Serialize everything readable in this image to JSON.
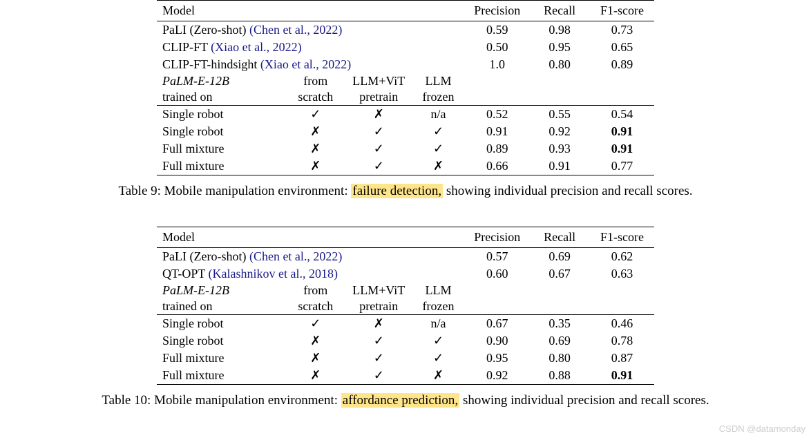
{
  "table9": {
    "headers": {
      "model": "Model",
      "precision": "Precision",
      "recall": "Recall",
      "f1": "F1-score"
    },
    "baselines": [
      {
        "name": "PaLI (Zero-shot) ",
        "cite": "(Chen et al., 2022)",
        "precision": "0.59",
        "recall": "0.98",
        "f1": "0.73"
      },
      {
        "name": "CLIP-FT ",
        "cite": "(Xiao et al., 2022)",
        "precision": "0.50",
        "recall": "0.95",
        "f1": "0.65"
      },
      {
        "name": "CLIP-FT-hindsight ",
        "cite": "(Xiao et al., 2022)",
        "precision": "1.0",
        "recall": "0.80",
        "f1": "0.89"
      }
    ],
    "subheader": {
      "model_name": "PaLM-E-12B",
      "trained_on": "trained on",
      "col1_top": "from",
      "col1_bot": "scratch",
      "col2_top": "LLM+ViT",
      "col2_bot": "pretrain",
      "col3_top": "LLM",
      "col3_bot": "frozen"
    },
    "rows": [
      {
        "label": "Single robot",
        "c1": "✓",
        "c2": "✗",
        "c3": "n/a",
        "precision": "0.52",
        "recall": "0.55",
        "f1": "0.54",
        "f1_bold": false
      },
      {
        "label": "Single robot",
        "c1": "✗",
        "c2": "✓",
        "c3": "✓",
        "precision": "0.91",
        "recall": "0.92",
        "f1": "0.91",
        "f1_bold": true
      },
      {
        "label": "Full mixture",
        "c1": "✗",
        "c2": "✓",
        "c3": "✓",
        "precision": "0.89",
        "recall": "0.93",
        "f1": "0.91",
        "f1_bold": true
      },
      {
        "label": "Full mixture",
        "c1": "✗",
        "c2": "✓",
        "c3": "✗",
        "precision": "0.66",
        "recall": "0.91",
        "f1": "0.77",
        "f1_bold": false
      }
    ],
    "caption_prefix": "Table 9: Mobile manipulation environment: ",
    "caption_highlight": "failure detection,",
    "caption_suffix": " showing individual precision and recall scores."
  },
  "table10": {
    "headers": {
      "model": "Model",
      "precision": "Precision",
      "recall": "Recall",
      "f1": "F1-score"
    },
    "baselines": [
      {
        "name": "PaLI (Zero-shot) ",
        "cite": "(Chen et al., 2022)",
        "precision": "0.57",
        "recall": "0.69",
        "f1": "0.62"
      },
      {
        "name": "QT-OPT ",
        "cite": "(Kalashnikov et al., 2018)",
        "precision": "0.60",
        "recall": "0.67",
        "f1": "0.63"
      }
    ],
    "subheader": {
      "model_name": "PaLM-E-12B",
      "trained_on": "trained on",
      "col1_top": "from",
      "col1_bot": "scratch",
      "col2_top": "LLM+ViT",
      "col2_bot": "pretrain",
      "col3_top": "LLM",
      "col3_bot": "frozen"
    },
    "rows": [
      {
        "label": "Single robot",
        "c1": "✓",
        "c2": "✗",
        "c3": "n/a",
        "precision": "0.67",
        "recall": "0.35",
        "f1": "0.46",
        "f1_bold": false
      },
      {
        "label": "Single robot",
        "c1": "✗",
        "c2": "✓",
        "c3": "✓",
        "precision": "0.90",
        "recall": "0.69",
        "f1": "0.78",
        "f1_bold": false
      },
      {
        "label": "Full mixture",
        "c1": "✗",
        "c2": "✓",
        "c3": "✓",
        "precision": "0.95",
        "recall": "0.80",
        "f1": "0.87",
        "f1_bold": false
      },
      {
        "label": "Full mixture",
        "c1": "✗",
        "c2": "✓",
        "c3": "✗",
        "precision": "0.92",
        "recall": "0.88",
        "f1": "0.91",
        "f1_bold": true
      }
    ],
    "caption_prefix": "Table 10: Mobile manipulation environment: ",
    "caption_highlight": "affordance prediction,",
    "caption_suffix": " showing individual precision and recall scores."
  },
  "watermark": "CSDN @datamonday"
}
